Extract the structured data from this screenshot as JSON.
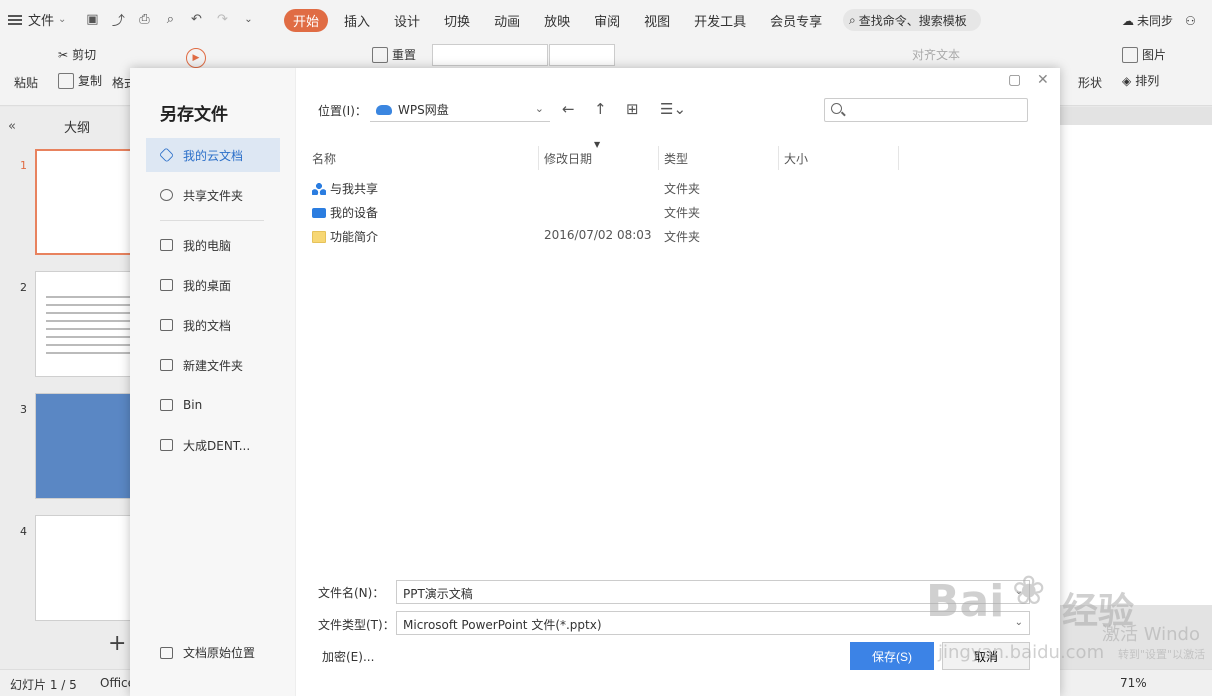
{
  "menubar": {
    "file_label": "文件",
    "tabs": [
      {
        "label": "开始",
        "active": true
      },
      {
        "label": "插入"
      },
      {
        "label": "设计"
      },
      {
        "label": "切换"
      },
      {
        "label": "动画"
      },
      {
        "label": "放映"
      },
      {
        "label": "审阅"
      },
      {
        "label": "视图"
      },
      {
        "label": "开发工具"
      },
      {
        "label": "会员专享"
      }
    ],
    "search_label": "查找命令、搜索模板",
    "sync_label": "未同步"
  },
  "ribbon": {
    "cut": "剪切",
    "paste": "粘贴",
    "copy": "复制",
    "format": "格式",
    "reset": "重置",
    "align_text": "对齐文本",
    "picture": "图片",
    "shape": "形状",
    "arrange": "排列"
  },
  "left_panel": {
    "outline_label": "大纲",
    "slides": [
      {
        "number": "1",
        "active": true
      },
      {
        "number": "2"
      },
      {
        "number": "3"
      },
      {
        "number": "4"
      }
    ]
  },
  "statusbar": {
    "slide_counter": "幻灯片 1 / 5",
    "theme": "Office",
    "zoom": "71%"
  },
  "dialog": {
    "title": "另存文件",
    "sidebar": [
      {
        "label": "我的云文档",
        "active": true
      },
      {
        "label": "共享文件夹"
      },
      {
        "label": "我的电脑"
      },
      {
        "label": "我的桌面"
      },
      {
        "label": "我的文档"
      },
      {
        "label": "新建文件夹"
      },
      {
        "label": "Bin"
      },
      {
        "label": "大成DENT..."
      }
    ],
    "original_location": "文档原始位置",
    "location_label": "位置(I)：",
    "location_value": "WPS网盘",
    "columns": {
      "name": "名称",
      "modified": "修改日期",
      "type": "类型",
      "size": "大小"
    },
    "files": [
      {
        "name": "与我共享",
        "modified": "",
        "type": "文件夹",
        "icon": "share-icon"
      },
      {
        "name": "我的设备",
        "modified": "",
        "type": "文件夹",
        "icon": "device-icon"
      },
      {
        "name": "功能简介",
        "modified": "2016/07/02 08:03",
        "type": "文件夹",
        "icon": "folder-icon"
      }
    ],
    "filename_label": "文件名(N)：",
    "filename_value": "PPT演示文稿",
    "filetype_label": "文件类型(T)：",
    "filetype_value": "Microsoft PowerPoint 文件(*.pptx)",
    "encrypt_label": "加密(E)...",
    "save_label": "保存(S)",
    "cancel_label": "取消"
  },
  "watermark": {
    "brand": "Bai",
    "brand_cn": "经验",
    "url": "jingyan.baidu.com",
    "activation_title": "激活 Windo",
    "activation_sub": "转到\"设置\"以激活"
  }
}
